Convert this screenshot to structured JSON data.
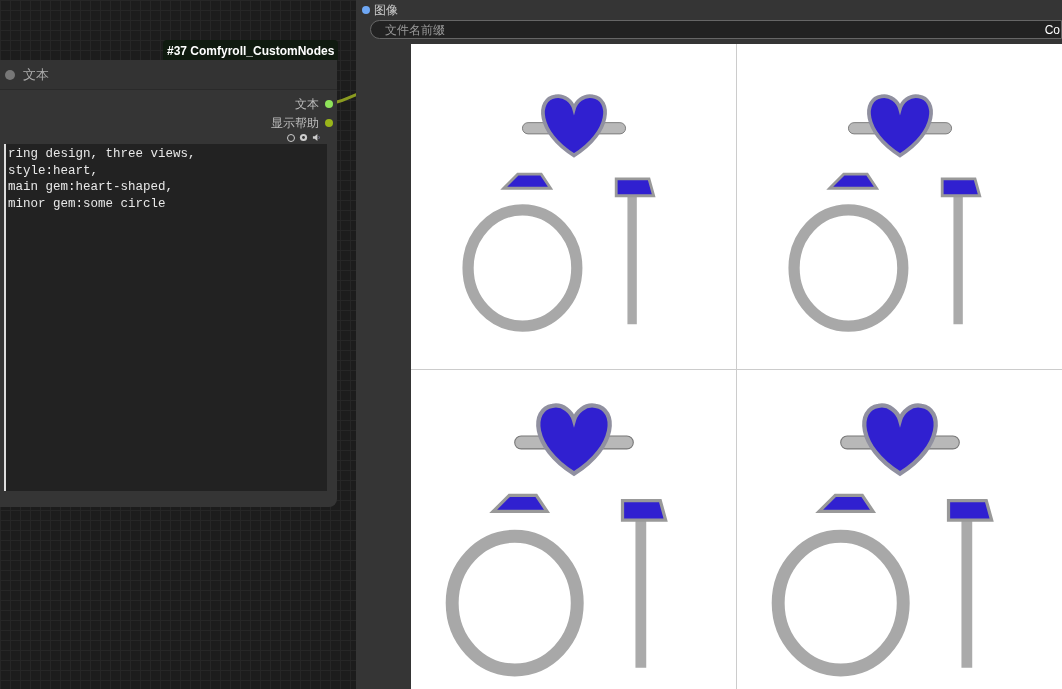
{
  "text_node": {
    "badge": "#37 Comfyroll_CustomNodes",
    "title": "文本",
    "outputs": [
      {
        "label": "文本",
        "color": "#8fe35a"
      },
      {
        "label": "显示帮助",
        "color": "#9ab51a"
      }
    ],
    "text": "ring design, three views,\nstyle:heart,\nmain gem:heart-shaped,\nminor gem:some circle"
  },
  "save_node": {
    "input": {
      "label": "图像",
      "color": "#6fa8f5"
    },
    "field": {
      "label": "文件名前缀",
      "value": "Co"
    }
  }
}
